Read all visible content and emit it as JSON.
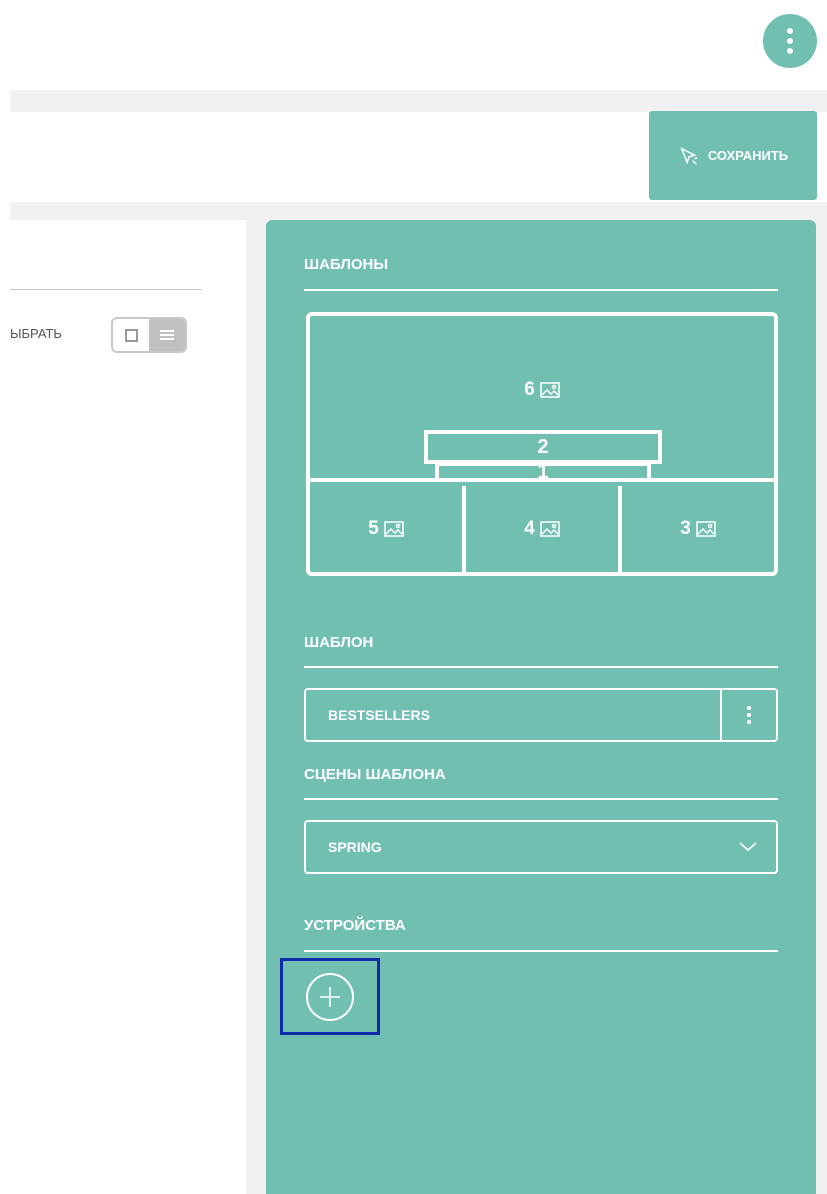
{
  "header": {
    "menu_icon": "vertical-dots-icon",
    "save_label": "СОХРАНИТЬ",
    "save_icon": "cursor-pointer-icon"
  },
  "left": {
    "select_label": "ЫБРАТЬ"
  },
  "templates": {
    "title": "ШАБЛОНЫ",
    "zones": {
      "z6": "6",
      "z2": "2",
      "z1": "1",
      "z5": "5",
      "z4": "4",
      "z3": "3"
    }
  },
  "template": {
    "title": "ШАБЛОН",
    "value": "BESTSELLERS"
  },
  "scenes": {
    "title": "СЦЕНЫ ШАБЛОНА",
    "value": "SPRING"
  },
  "devices": {
    "title": "УСТРОЙСТВА",
    "add_icon": "plus-circle-icon"
  },
  "colors": {
    "accent": "#71bfb1",
    "highlight": "#0e2aa8"
  }
}
